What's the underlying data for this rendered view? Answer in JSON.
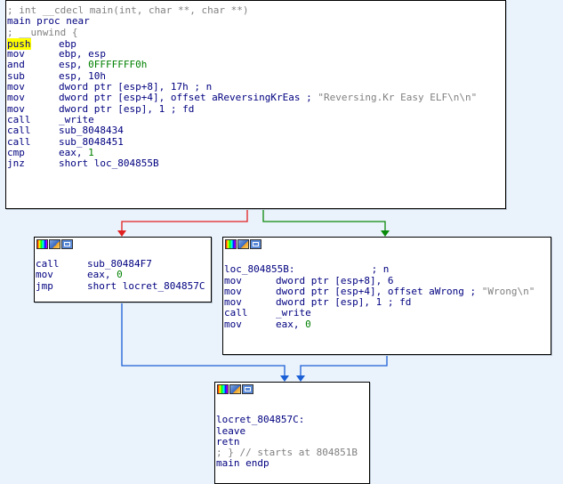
{
  "top_node": {
    "lines": [
      {
        "kind": "cmt",
        "text": "; int __cdecl main(int, char **, char **)"
      },
      {
        "kind": "dir",
        "text": "main proc near"
      },
      {
        "kind": "cmt",
        "text": "; __unwind {"
      },
      {
        "kind": "ins",
        "mn": "push",
        "op": "ebp",
        "hl": true
      },
      {
        "kind": "ins",
        "mn": "mov",
        "op": "ebp, esp"
      },
      {
        "kind": "ins",
        "mn": "and",
        "op": "esp, ",
        "num": "0FFFFFFF0h"
      },
      {
        "kind": "ins",
        "mn": "sub",
        "op": "esp, 10h"
      },
      {
        "kind": "ins",
        "mn": "mov",
        "op": "dword ptr [esp+8], 17h ; n"
      },
      {
        "kind": "ins",
        "mn": "mov",
        "op": "dword ptr [esp+4], offset aReversingKrEas ; ",
        "str": "\"Reversing.Kr Easy ELF\\n\\n\""
      },
      {
        "kind": "ins",
        "mn": "mov",
        "op": "dword ptr [esp], 1 ; fd"
      },
      {
        "kind": "ins",
        "mn": "call",
        "op": "_write"
      },
      {
        "kind": "ins",
        "mn": "call",
        "op": "sub_8048434"
      },
      {
        "kind": "ins",
        "mn": "call",
        "op": "sub_8048451"
      },
      {
        "kind": "ins",
        "mn": "cmp",
        "op": "eax, ",
        "num": "1"
      },
      {
        "kind": "ins",
        "mn": "jnz",
        "op": "short loc_804855B"
      }
    ]
  },
  "left_node": {
    "lines": [
      {
        "kind": "ins",
        "mn": "call",
        "op": "sub_80484F7"
      },
      {
        "kind": "ins",
        "mn": "mov",
        "op": "eax, ",
        "num": "0"
      },
      {
        "kind": "ins",
        "mn": "jmp",
        "op": "short locret_804857C"
      }
    ]
  },
  "right_node": {
    "lines": [
      {
        "kind": "blank",
        "text": ""
      },
      {
        "kind": "dir",
        "text": "loc_804855B:             ; n"
      },
      {
        "kind": "ins",
        "mn": "mov",
        "op": "dword ptr [esp+8], 6"
      },
      {
        "kind": "ins",
        "mn": "mov",
        "op": "dword ptr [esp+4], offset aWrong ; ",
        "str": "\"Wrong\\n\""
      },
      {
        "kind": "ins",
        "mn": "mov",
        "op": "dword ptr [esp], 1 ; fd"
      },
      {
        "kind": "ins",
        "mn": "call",
        "op": "_write"
      },
      {
        "kind": "ins",
        "mn": "mov",
        "op": "eax, ",
        "num": "0"
      }
    ]
  },
  "bottom_node": {
    "lines": [
      {
        "kind": "blank",
        "text": ""
      },
      {
        "kind": "dir",
        "text": "locret_804857C:"
      },
      {
        "kind": "dir",
        "text": "leave"
      },
      {
        "kind": "dir",
        "text": "retn"
      },
      {
        "kind": "cmt",
        "text": "; } // starts at 804851B"
      },
      {
        "kind": "dir",
        "text": "main endp"
      }
    ]
  },
  "colors": {
    "background": "#eaf2fb",
    "edge_false": "#ff0000",
    "edge_true": "#008000",
    "edge_uncond": "#1a5fd6",
    "highlight": "#ffff00"
  },
  "icons": [
    "color-palette-icon",
    "edit-node-icon",
    "graph-overview-icon"
  ]
}
